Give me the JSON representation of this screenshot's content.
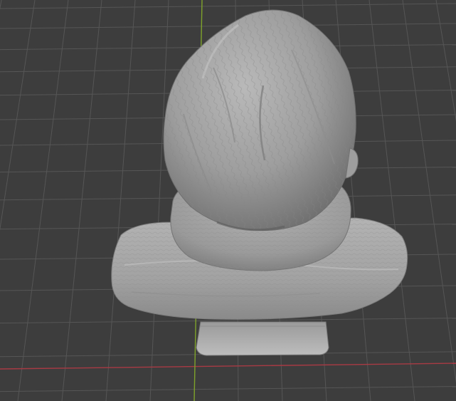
{
  "viewport": {
    "mode": "3D Viewport",
    "object": "sculpted-bust-back-view",
    "background_color": "#3d3d3d",
    "grid_color": "#565656",
    "x_axis_color": "#a83a44",
    "y_axis_color": "#7ea22a",
    "mesh_color": "#a8a8a8"
  }
}
